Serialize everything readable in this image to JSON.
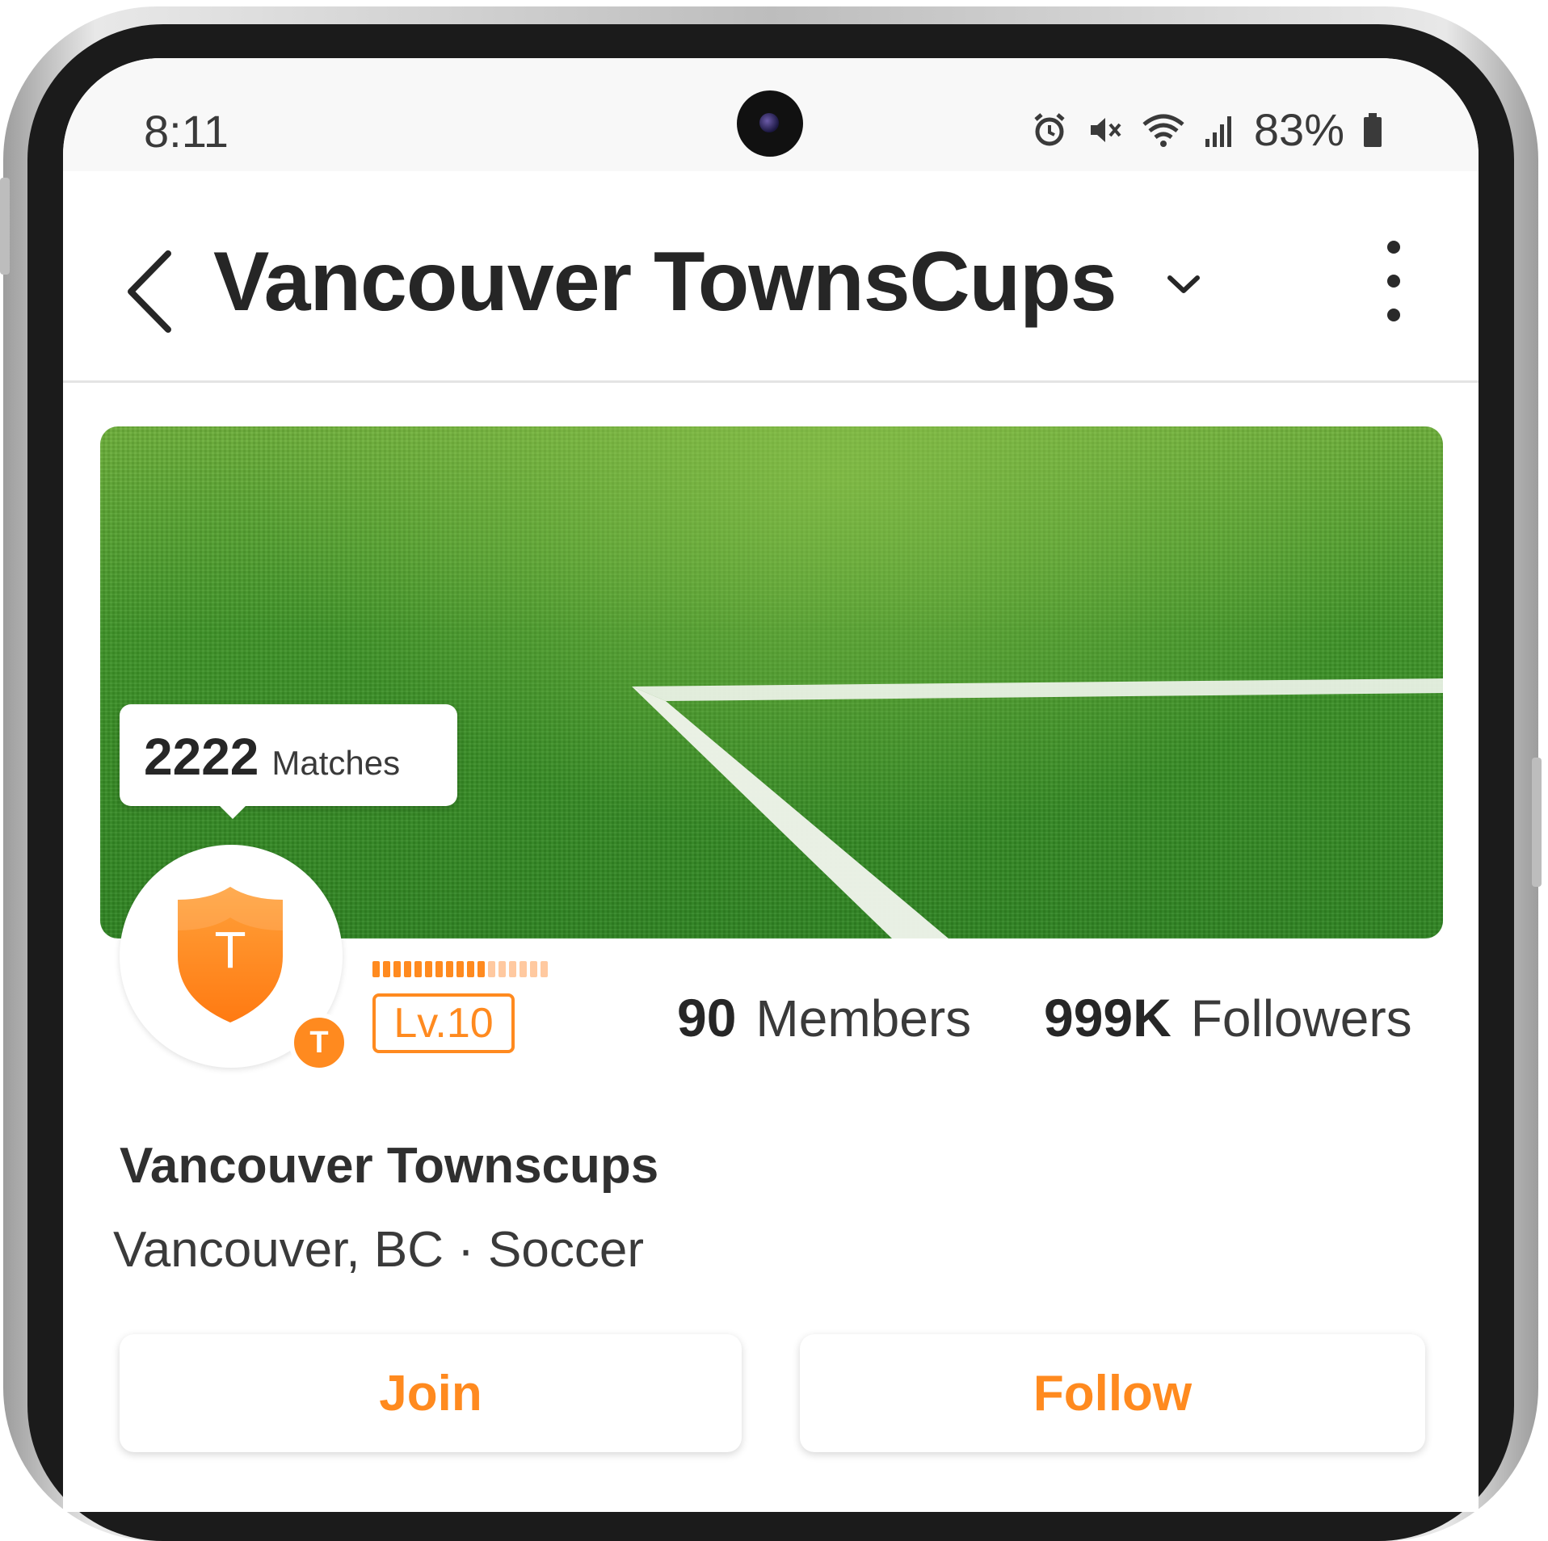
{
  "status_bar": {
    "time": "8:11",
    "battery_percent": "83%",
    "icons": [
      "alarm-icon",
      "mute-icon",
      "wifi-icon",
      "signal-icon",
      "battery-icon"
    ]
  },
  "header": {
    "title": "Vancouver TownsCups",
    "icons": [
      "back-arrow-icon",
      "chevron-down-icon",
      "more-vertical-icon"
    ]
  },
  "tooltip": {
    "count": "2222",
    "label": "Matches"
  },
  "avatar": {
    "shield_letter": "T",
    "badge_letter": "T"
  },
  "level": {
    "label": "Lv.10",
    "progress_filled": 11,
    "progress_total": 17
  },
  "stats": {
    "members_value": "90",
    "members_label": "Members",
    "followers_value": "999K",
    "followers_label": "Followers"
  },
  "club": {
    "name": "Vancouver Townscups",
    "meta": "Vancouver, BC · Soccer"
  },
  "buttons": {
    "join_label": "Join",
    "follow_label": "Follow"
  },
  "colors": {
    "accent": "#ff8a1f",
    "accent_light": "#ffc9a0",
    "text_primary": "#262626",
    "grass": "#3f9428"
  }
}
